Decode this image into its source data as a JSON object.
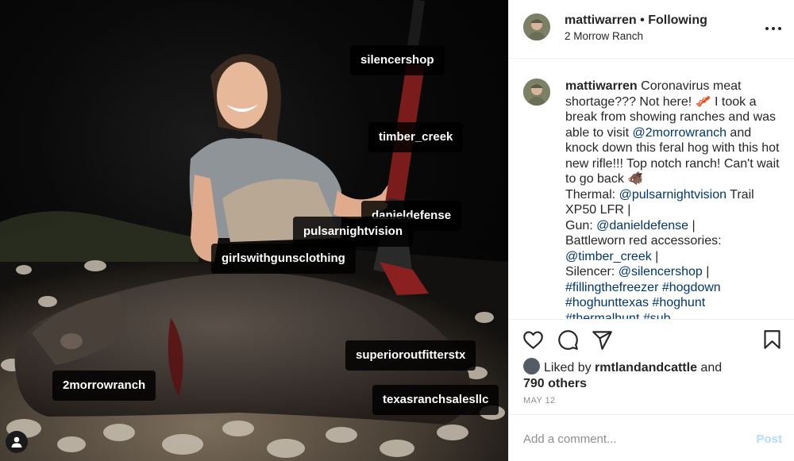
{
  "post": {
    "username": "mattiwarren",
    "separator": "•",
    "follow_status": "Following",
    "location": "2 Morrow Ranch",
    "caption": {
      "text_1": "Coronavirus meat shortage??? Not here! 🥓 I took a break from showing ranches and was able to visit ",
      "mention_1": "@2morrowranch",
      "text_2": " and knock down this feral hog with this hot new rifle!!! Top notch ranch! Can't wait to go back 🐗",
      "thermal_label": "Thermal: ",
      "mention_thermal": "@pulsarnightvision",
      "thermal_text": " Trail XP50 LFR |",
      "gun_label": "Gun: ",
      "mention_gun": "@danieldefense",
      "gun_text": " |",
      "battleworn": "Battleworn red accessories:",
      "mention_battleworn": "@timber_creek",
      "battleworn_text": " |",
      "silencer_label": "Silencer: ",
      "mention_silencer": "@silencershop",
      "silencer_text": " |",
      "hashtags_1": "#fillingthefreezer #hogdown",
      "hashtags_2": "#hoghunttexas #hoghunt",
      "hashtags_3": "#thermalhunt #sub"
    },
    "likes": {
      "prefix": "Liked by ",
      "user": "rmtlandandcattle",
      "and": " and",
      "others": "790 others"
    },
    "date": "MAY 12",
    "comment_placeholder": "Add a comment...",
    "post_label": "Post"
  },
  "photo_tags": {
    "silencershop": "silencershop",
    "timber_creek": "timber_creek",
    "danieldefense": "danieldefense",
    "pulsarnightvision": "pulsarnightvision",
    "girlswithgunsclothing": "girlswithgunsclothing",
    "superioroutfitterstx": "superioroutfitterstx",
    "2morrowranch": "2morrowranch",
    "texasranchsalesllc": "texasranchsalesllc"
  },
  "icons": [
    "more-icon",
    "heart-icon",
    "comment-icon",
    "share-icon",
    "bookmark-icon",
    "tagged-user-icon"
  ],
  "colors": {
    "link": "#00376b",
    "muted": "#8e8e8e",
    "post_disabled": "#b3dbff",
    "tag_bg": "#000000"
  }
}
